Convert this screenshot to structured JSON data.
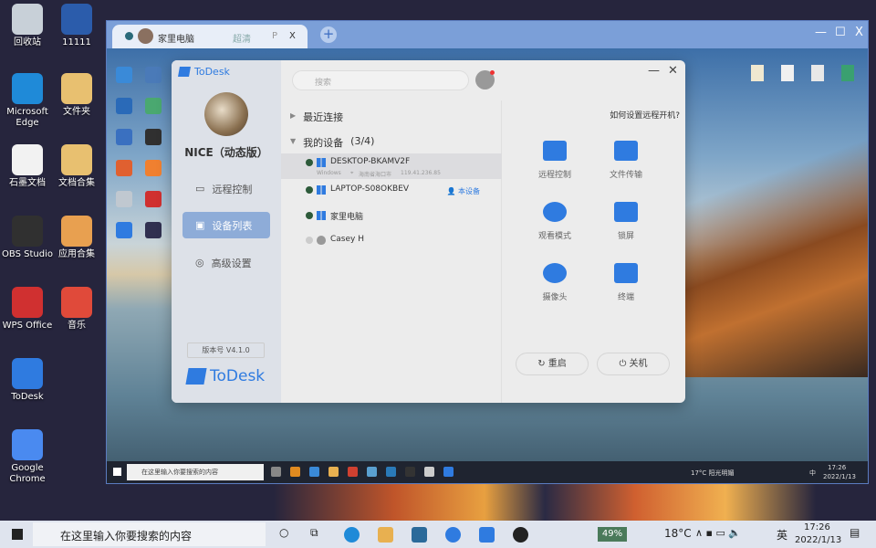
{
  "desktop": {
    "icons": [
      {
        "label": "回收站",
        "color": "#c8d0d8"
      },
      {
        "label": "11111",
        "color": "#2b5cab"
      },
      {
        "label": "Microsoft Edge",
        "color": "#1f8ad8"
      },
      {
        "label": "文件夹",
        "color": "#e8c070"
      },
      {
        "label": "石墨文档",
        "color": "#f2f2f2"
      },
      {
        "label": "文档合集",
        "color": "#e8c070"
      },
      {
        "label": "OBS Studio",
        "color": "#303030"
      },
      {
        "label": "应用合集",
        "color": "#e8a050"
      },
      {
        "label": "WPS Office",
        "color": "#d03030"
      },
      {
        "label": "音乐",
        "color": "#e04a3a"
      },
      {
        "label": "ToDesk",
        "color": "#2f7be0"
      },
      {
        "label": "Google Chrome",
        "color": "#4a8af0"
      }
    ]
  },
  "remote_window": {
    "tab": {
      "title": "家里电脑",
      "quality": "超清",
      "p": "P",
      "close": "X"
    },
    "new_tab": "+",
    "minimize": "—",
    "maximize": "☐",
    "close": "X",
    "taskbar": {
      "search_placeholder": "在这里输入你要搜索的内容",
      "weather": "17°C 阳光明媚",
      "ime": "中",
      "time": "17:26",
      "date": "2022/1/13"
    }
  },
  "todesk": {
    "app_name": "ToDesk",
    "user_name": "NICE（动态版）",
    "nav": [
      {
        "label": "远程控制",
        "icon": "monitor-icon"
      },
      {
        "label": "设备列表",
        "icon": "devices-icon",
        "active": true
      },
      {
        "label": "高级设置",
        "icon": "settings-icon"
      }
    ],
    "version": "版本号 V4.1.0",
    "search_placeholder": "搜索",
    "minimize": "—",
    "close": "✕",
    "groups": {
      "recent": "最近连接",
      "mine": "我的设备",
      "mine_count": "(3/4)"
    },
    "devices": [
      {
        "name": "DESKTOP-BKAMV2F",
        "os": "windows",
        "online": true,
        "selected": true,
        "os_label": "Windows",
        "location": "海南省海口市",
        "ip": "119.41.236.85"
      },
      {
        "name": "LAPTOP-S08OKBEV",
        "os": "windows",
        "online": true,
        "badge": "本设备"
      },
      {
        "name": "家里电脑",
        "os": "windows",
        "online": true
      },
      {
        "name": "Casey H",
        "os": "apple",
        "online": false
      }
    ],
    "help_link": "如何设置远程开机?",
    "actions": [
      {
        "label": "远程控制",
        "icon": "remote-control-icon"
      },
      {
        "label": "文件传输",
        "icon": "file-transfer-icon"
      },
      {
        "label": "观看模式",
        "icon": "eye-icon"
      },
      {
        "label": "锁屏",
        "icon": "lock-icon"
      },
      {
        "label": "摄像头",
        "icon": "camera-icon"
      },
      {
        "label": "终端",
        "icon": "terminal-icon"
      }
    ],
    "restart": "重启",
    "shutdown": "关机",
    "accent": "#2f7be0"
  },
  "host_taskbar": {
    "search_placeholder": "在这里输入你要搜索的内容",
    "battery": "49%",
    "weather": "18°C",
    "ime": "英",
    "time": "17:26",
    "date": "2022/1/13"
  }
}
